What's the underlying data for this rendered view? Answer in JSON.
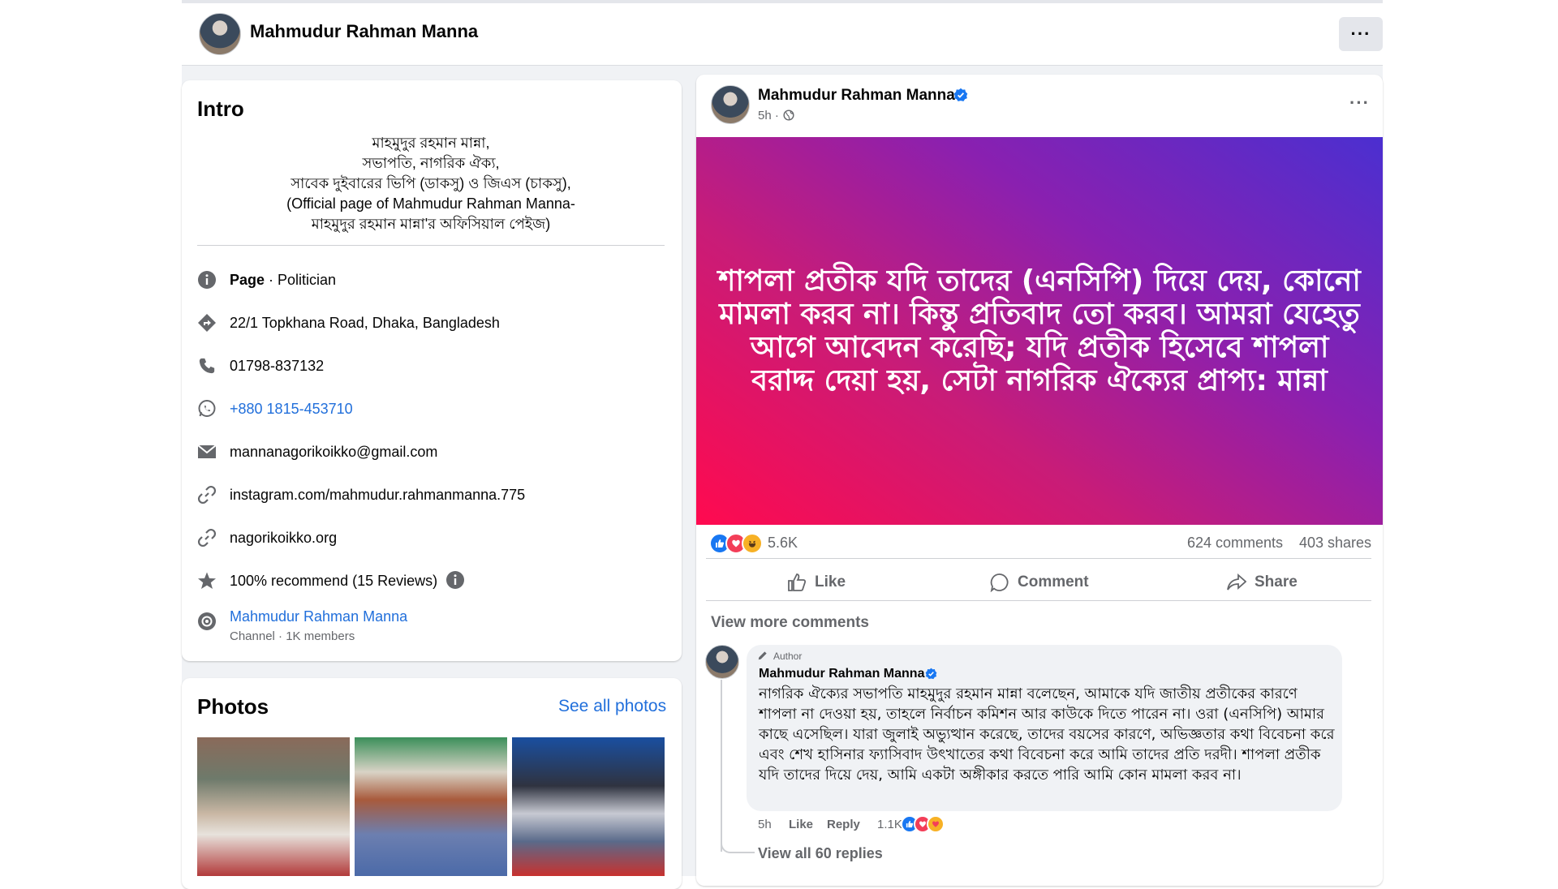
{
  "header": {
    "page_name": "Mahmudur Rahman Manna"
  },
  "intro": {
    "title": "Intro",
    "bio": [
      "মাহমুদুর রহমান মান্না,",
      "সভাপতি, নাগরিক ঐক্য,",
      "সাবেক দুইবারের ভিপি (ডাকসু) ও জিএস (চাকসু),",
      "(Official page of Mahmudur Rahman Manna-",
      "মাহমুদুর রহমান মান্না'র অফিসিয়াল পেইজ)"
    ],
    "page_label": "Page",
    "category": " · Politician",
    "address": "22/1 Topkhana Road, Dhaka, Bangladesh",
    "phone": "01798-837132",
    "whatsapp": "+880 1815-453710",
    "email": "mannanagorikoikko@gmail.com",
    "instagram": "instagram.com/mahmudur.rahmanmanna.775",
    "website": "nagorikoikko.org",
    "recommend": "100% recommend (15 Reviews)",
    "channel_name": "Mahmudur Rahman Manna",
    "channel_meta": "Channel · 1K members"
  },
  "photos": {
    "title": "Photos",
    "see_all": "See all photos"
  },
  "post": {
    "author": "Mahmudur Rahman Manna",
    "time": "5h ·",
    "media_text": "শাপলা প্রতীক যদি তাদের (এনসিপি) দিয়ে দেয়, কোনো মামলা করব না। কিন্তু প্রতিবাদ তো করব। আমরা যেহেতু আগে আবেদন করেছি; যদি প্রতীক হিসেবে শাপলা বরাদ্দ দেয়া হয়, সেটা নাগরিক ঐক্যের প্রাপ্য: মান্না",
    "reaction_count": "5.6K",
    "comments_count": "624 comments",
    "shares_count": "403 shares",
    "like_label": "Like",
    "comment_label": "Comment",
    "share_label": "Share",
    "view_more_comments": "View more comments"
  },
  "comment": {
    "badge": "Author",
    "author": "Mahmudur Rahman Manna",
    "text": "নাগরিক ঐক্যের সভাপতি মাহমুদুর রহমান মান্না বলেছেন, আমাকে যদি জাতীয় প্রতীকের কারণে শাপলা না দেওয়া হয়, তাহলে নির্বাচন কমিশন আর কাউকে দিতে পারেন না। ওরা (এনসিপি) আমার কাছে এসেছিল। যারা জুলাই অভ্যুত্থান করেছে, তাদের বয়সের কারণে, অভিজ্ঞতার কথা বিবেচনা করে এবং শেখ হাসিনার ফ্যাসিবাদ উৎখাতের কথা বিবেচনা করে আমি তাদের প্রতি দরদী। শাপলা প্রতীক যদি তাদের দিয়ে দেয়, আমি একটা অঙ্গীকার করতে পারি আমি কোন মামলা করব না।",
    "time": "5h",
    "like": "Like",
    "reply": "Reply",
    "reactions": "1.1K",
    "view_replies": "View all 60 replies"
  },
  "colors": {
    "accent": "#216fdb",
    "like_blue": "#1877f2",
    "love_red": "#f33e58",
    "haha_yellow": "#f7b125"
  }
}
